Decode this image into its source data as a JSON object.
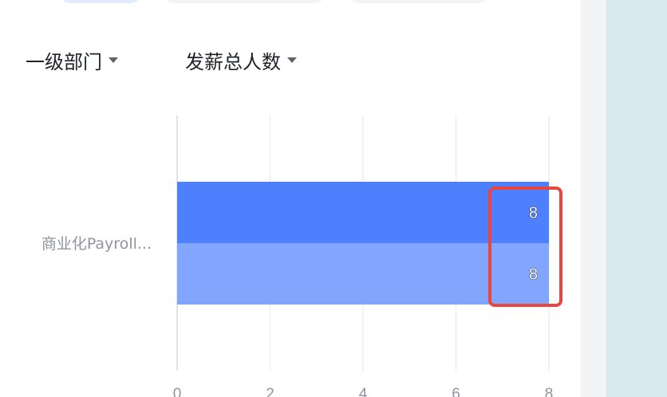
{
  "selectors": {
    "dimension": "一级部门",
    "metric": "发薪总人数"
  },
  "colors": {
    "series_1": "#4e80fe",
    "series_2": "#82a6fe",
    "highlight": "#e8463f"
  },
  "chart_data": {
    "type": "bar",
    "orientation": "horizontal",
    "categories": [
      "商业化Payroll..."
    ],
    "series": [
      {
        "values": [
          8
        ]
      },
      {
        "values": [
          8
        ]
      }
    ],
    "x_ticks": [
      "0",
      "2",
      "4",
      "6",
      "8"
    ],
    "xlim": [
      0,
      8
    ],
    "grid": true,
    "data_labels": true
  }
}
